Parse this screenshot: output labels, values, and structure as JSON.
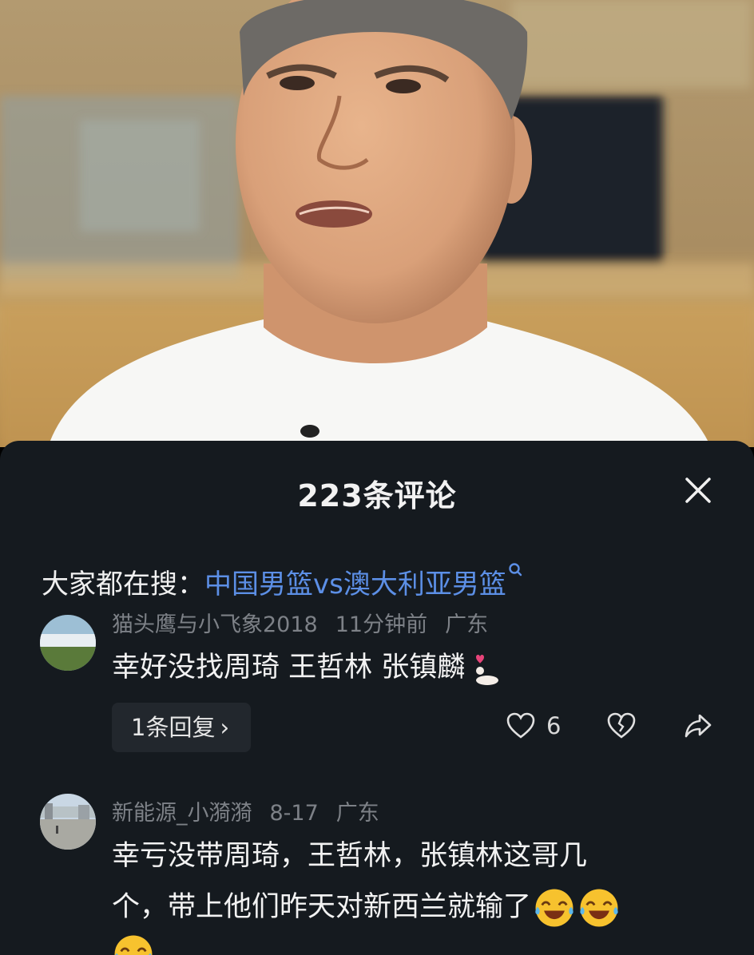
{
  "sheet": {
    "title": "223条评论",
    "close_icon": "close-icon"
  },
  "search": {
    "prefix": "大家都在搜：",
    "query": "中国男篮vs澳大利亚男篮",
    "icon": "search-icon"
  },
  "comments": [
    {
      "username": "猫头鹰与小飞象2018",
      "time": "11分钟前",
      "location": "广东",
      "text": "幸好没找周琦 王哲林 张镇麟",
      "emoji": [
        "shy-emoji"
      ],
      "reply_label": "1条回复",
      "like_count": "6"
    },
    {
      "username": "新能源_小漪漪",
      "time": "8-17",
      "location": "广东",
      "text_line1": "幸亏没带周琦，王哲林，张镇林这哥几",
      "text_line2": "个，带上他们昨天对新西兰就输了",
      "emoji": [
        "laugh-cry-emoji",
        "laugh-cry-emoji",
        "laugh-cry-emoji"
      ]
    }
  ],
  "colors": {
    "sheet_bg": "#151a1f",
    "link_blue": "#5c8fe6",
    "meta_gray": "#7d8187",
    "reply_bg": "#22272d"
  }
}
